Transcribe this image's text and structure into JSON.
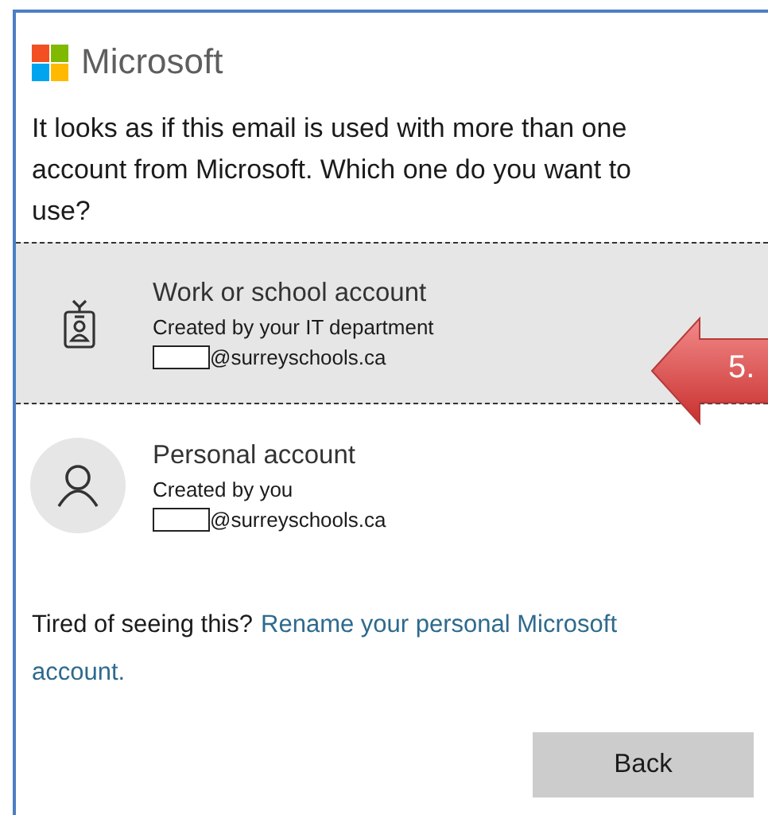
{
  "brand": "Microsoft",
  "prompt": "It looks as if this email is used with more than one account from Microsoft. Which one do you want to use?",
  "accounts": [
    {
      "kind": "work",
      "title": "Work or school account",
      "subtitle": "Created by your IT department",
      "email": "@surreyschools.ca",
      "selected": true
    },
    {
      "kind": "personal",
      "title": "Personal account",
      "subtitle": "Created by you",
      "email": "@surreyschools.ca",
      "selected": false
    }
  ],
  "footer": {
    "text": "Tired of seeing this?",
    "link_lines": [
      "Rename your personal Microsoft",
      "account."
    ]
  },
  "back_button": "Back",
  "callout": {
    "label": "5."
  }
}
